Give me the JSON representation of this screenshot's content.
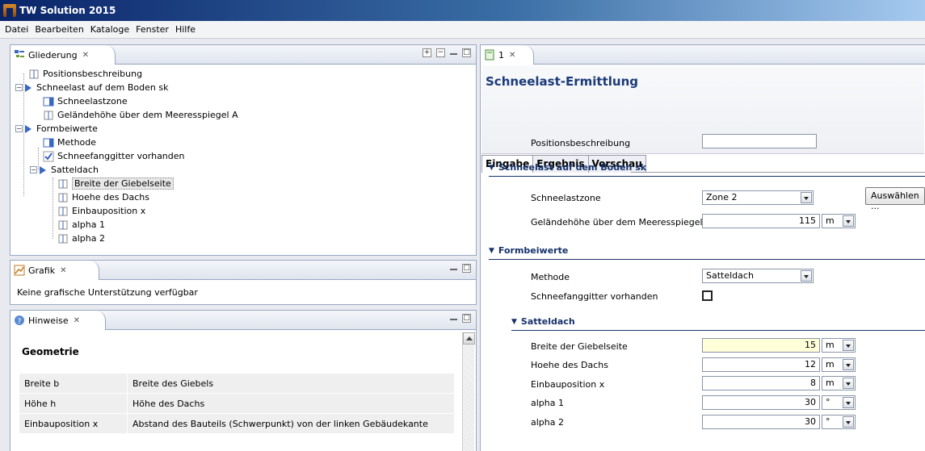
{
  "window": {
    "title": "TW Solution 2015"
  },
  "menu": [
    "Datei",
    "Bearbeiten",
    "Kataloge",
    "Fenster",
    "Hilfe"
  ],
  "outline": {
    "tab_label": "Gliederung",
    "items": [
      "Positionsbeschreibung",
      "Schneelast auf dem Boden sk",
      "Schneelastzone",
      "Geländehöhe über dem Meeresspiegel A",
      "Formbeiwerte",
      "Methode",
      "Schneefanggitter vorhanden",
      "Satteldach",
      "Breite der Giebelseite",
      "Hoehe des Dachs",
      "Einbauposition x",
      "alpha 1",
      "alpha 2"
    ]
  },
  "graphic": {
    "tab_label": "Grafik",
    "message": "Keine grafische Unterstützung verfügbar"
  },
  "hints": {
    "tab_label": "Hinweise",
    "heading": "Geometrie",
    "rows": [
      [
        "Breite b",
        "Breite des Giebels"
      ],
      [
        "Höhe h",
        "Höhe des Dachs"
      ],
      [
        "Einbauposition x",
        "Abstand des Bauteils (Schwerpunkt) von der linken Gebäudekante"
      ]
    ]
  },
  "editor": {
    "tab_label": "1",
    "title": "Schneelast-Ermittlung",
    "tabs": [
      "Eingabe",
      "Ergebnis",
      "Vorschau"
    ],
    "positionsbeschreibung_label": "Positionsbeschreibung",
    "positionsbeschreibung_value": "",
    "section_snow": "Schneelast auf dem Boden sk",
    "zone_label": "Schneelastzone",
    "zone_value": "Zone 2",
    "select_button": "Auswählen ...",
    "height_label": "Geländehöhe über dem Meeresspiegel A",
    "height_value": "115",
    "height_unit": "m",
    "section_form": "Formbeiwerte",
    "method_label": "Methode",
    "method_value": "Satteldach",
    "snowguard_label": "Schneefanggitter vorhanden",
    "section_roof": "Satteldach",
    "roof_fields": [
      {
        "label": "Breite der Giebelseite",
        "value": "15",
        "unit": "m"
      },
      {
        "label": "Hoehe des Dachs",
        "value": "12",
        "unit": "m"
      },
      {
        "label": "Einbauposition x",
        "value": "8",
        "unit": "m"
      },
      {
        "label": "alpha 1",
        "value": "30",
        "unit": "°"
      },
      {
        "label": "alpha 2",
        "value": "30",
        "unit": "°"
      }
    ]
  },
  "colors": {
    "accent": "#16316a",
    "highlight": "#ffffd8",
    "titlebar": "#0a246a"
  }
}
